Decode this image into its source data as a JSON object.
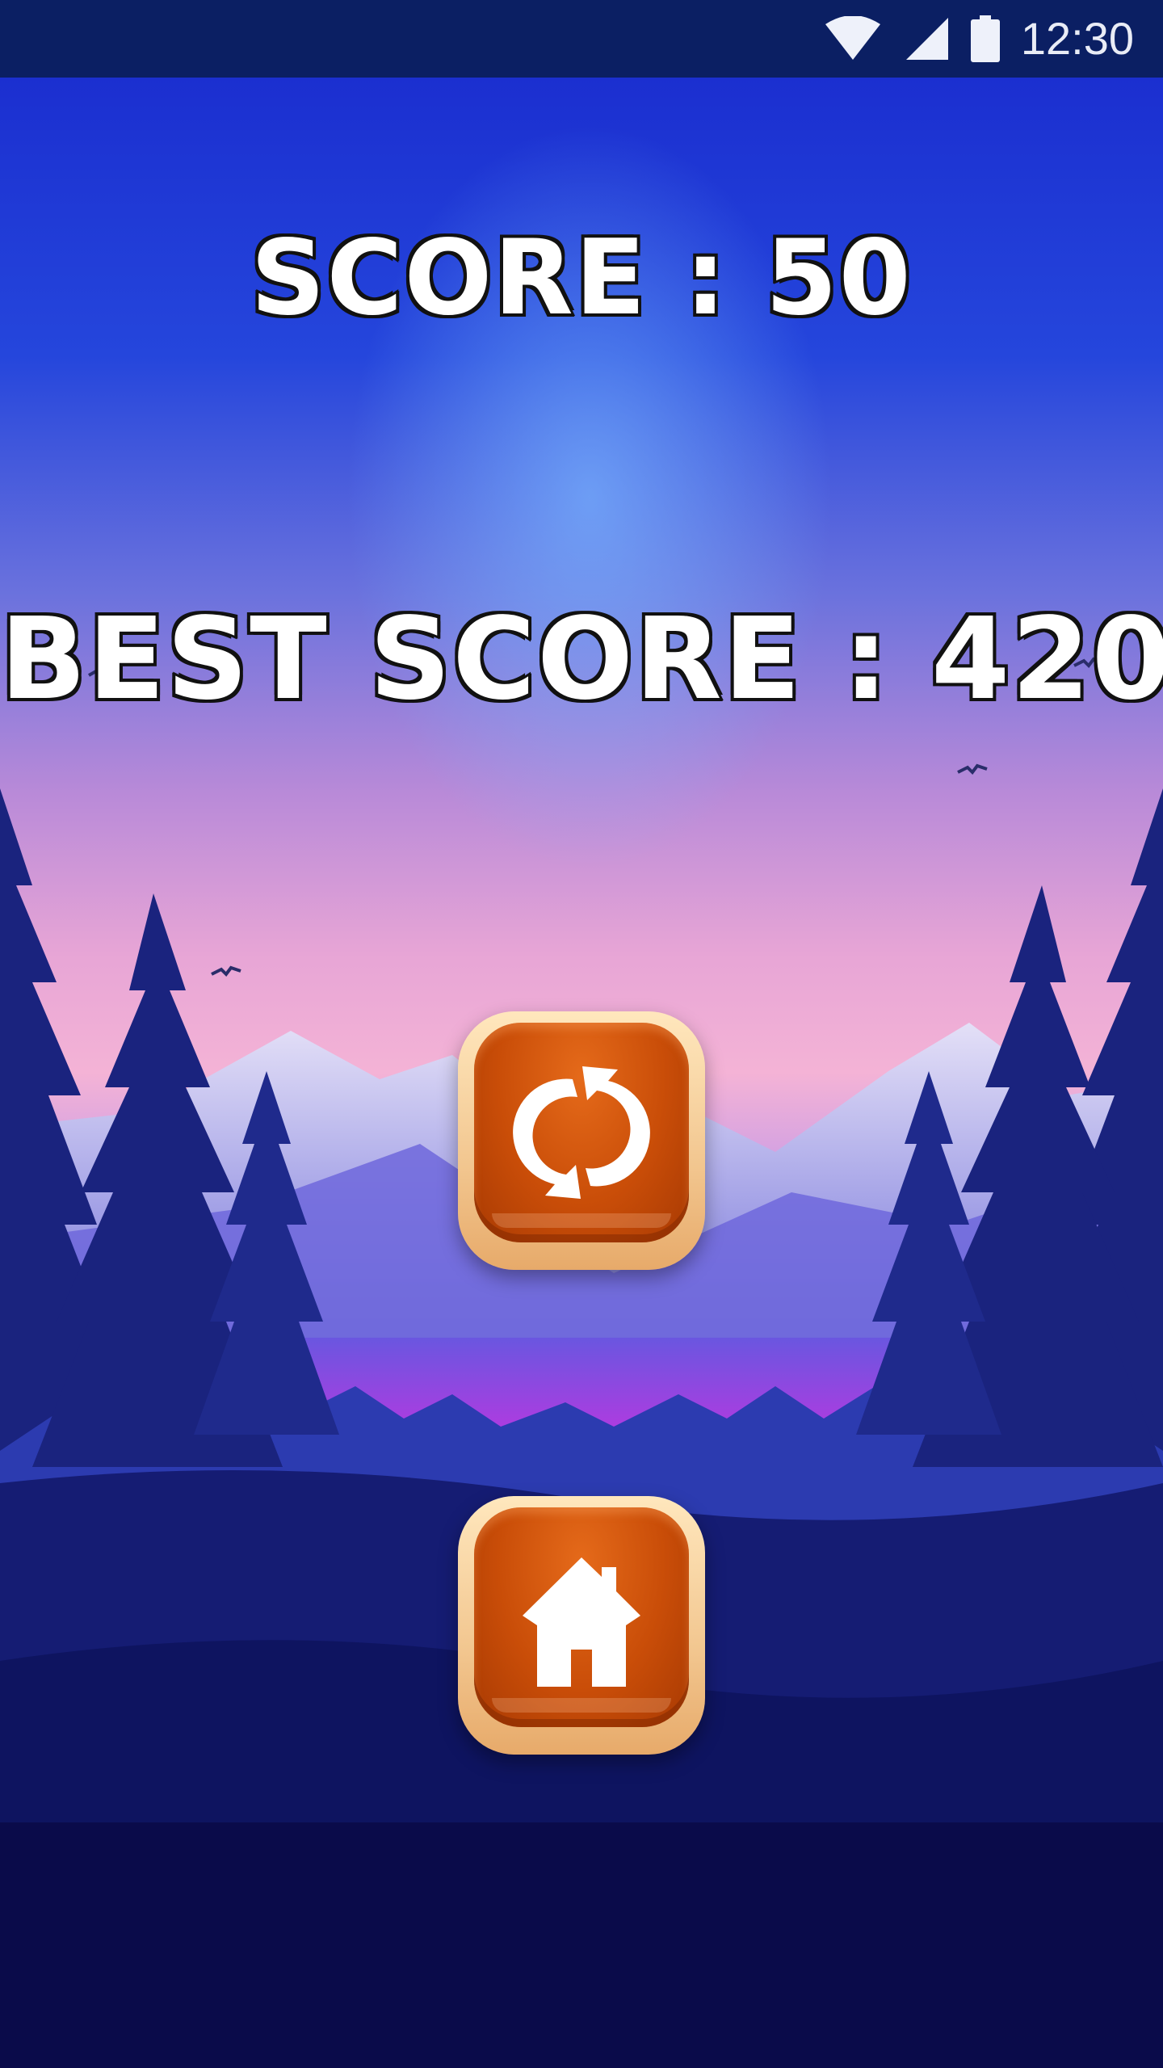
{
  "status_bar": {
    "time": "12:30",
    "icons": [
      "wifi-icon",
      "cell-signal-icon",
      "battery-icon"
    ]
  },
  "scores": {
    "score_text": "SCORE : 50",
    "best_score_text": "BEST SCORE : 420"
  },
  "buttons": {
    "replay_icon": "refresh-icon",
    "home_icon": "home-icon"
  },
  "colors": {
    "status_bar": "#0b1f63",
    "button_orange": "#c94d08",
    "button_rim": "#f2c68f",
    "sky_top": "#1f3fd6",
    "sky_bottom_pink": "#f2a9cf"
  }
}
